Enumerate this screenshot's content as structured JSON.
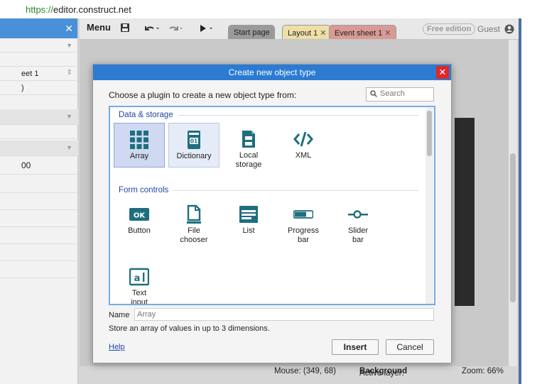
{
  "browser": {
    "url_protocol": "https://",
    "url_host": "editor.construct.net"
  },
  "left_panel": {
    "sheet_value": "eet 1",
    "value_one": ")",
    "value_two": "00"
  },
  "toolbar": {
    "menu_label": "Menu",
    "free_badge": "Free edition",
    "guest_label": "Guest"
  },
  "tabs": [
    {
      "label": "Start page",
      "active": false,
      "color": "#9a9a9a"
    },
    {
      "label": "Layout 1",
      "active": true,
      "color": "#eedfa6"
    },
    {
      "label": "Event sheet 1",
      "active": false,
      "color": "#d99a94"
    }
  ],
  "status": {
    "mouse": "Mouse: (349, 68)",
    "active_layer_label": "Active layer:",
    "active_layer_value": "Background",
    "zoom": "Zoom: 66%"
  },
  "dialog": {
    "title": "Create new object type",
    "prompt": "Choose a plugin to create a new object type from:",
    "search_placeholder": "Search",
    "groups": [
      {
        "title": "Data & storage",
        "items": [
          {
            "label": "Array",
            "icon": "grid-icon",
            "selected": true
          },
          {
            "label": "Dictionary",
            "icon": "dictionary-icon",
            "hover": true
          },
          {
            "label": "Local\nstorage",
            "icon": "local-storage-icon"
          },
          {
            "label": "XML",
            "icon": "xml-code-icon"
          }
        ]
      },
      {
        "title": "Form controls",
        "items": [
          {
            "label": "Button",
            "icon": "ok-button-icon"
          },
          {
            "label": "File\nchooser",
            "icon": "file-icon"
          },
          {
            "label": "List",
            "icon": "list-icon"
          },
          {
            "label": "Progress\nbar",
            "icon": "progress-bar-icon"
          },
          {
            "label": "Slider\nbar",
            "icon": "slider-icon"
          },
          {
            "label": "Text\ninput",
            "icon": "text-input-icon"
          }
        ]
      }
    ],
    "name_label": "Name",
    "name_value": "Array",
    "description": "Store an array of values in up to 3 dimensions.",
    "help_label": "Help",
    "insert_label": "Insert",
    "cancel_label": "Cancel"
  },
  "colors": {
    "accent": "#2b7bd3",
    "icon_teal": "#1f6e7e",
    "close_red": "#e0262a"
  }
}
